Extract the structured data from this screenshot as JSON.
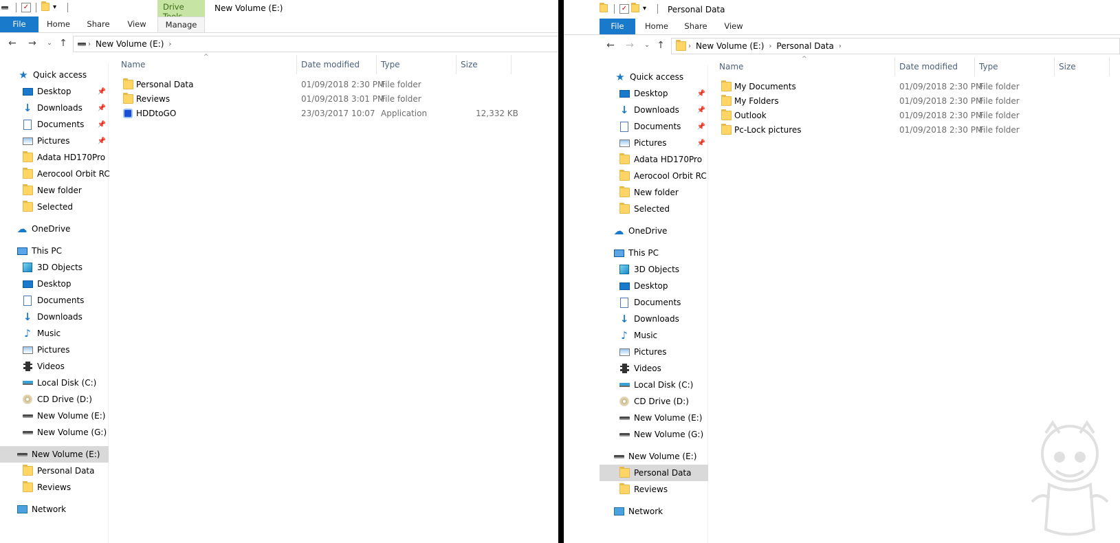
{
  "left": {
    "title": "New Volume (E:)",
    "context_tab_group": "Drive Tools",
    "tabs": {
      "file": "File",
      "home": "Home",
      "share": "Share",
      "view": "View",
      "manage": "Manage"
    },
    "address": {
      "crumb1": "New Volume (E:)"
    },
    "columns": {
      "name": "Name",
      "date": "Date modified",
      "type": "Type",
      "size": "Size"
    },
    "files": [
      {
        "name": "Personal Data",
        "date": "01/09/2018 2:30 PM",
        "type": "File folder",
        "size": ""
      },
      {
        "name": "Reviews",
        "date": "01/09/2018 3:01 PM",
        "type": "File folder",
        "size": ""
      },
      {
        "name": "HDDtoGO",
        "date": "23/03/2017 10:07",
        "type": "Application",
        "size": "12,332 KB"
      }
    ],
    "nav": {
      "quick_access": "Quick access",
      "qa_items": [
        "Desktop",
        "Downloads",
        "Documents",
        "Pictures",
        "Adata HD170Pro",
        "Aerocool Orbit RC",
        "New folder",
        "Selected"
      ],
      "onedrive": "OneDrive",
      "this_pc": "This PC",
      "pc_items": [
        "3D Objects",
        "Desktop",
        "Documents",
        "Downloads",
        "Music",
        "Pictures",
        "Videos",
        "Local Disk (C:)",
        "CD Drive (D:)",
        "New Volume (E:)",
        "New Volume (G:)"
      ],
      "expanded_drive": "New Volume (E:)",
      "drive_items": [
        "Personal Data",
        "Reviews"
      ],
      "network": "Network"
    }
  },
  "right": {
    "title": "Personal Data",
    "tabs": {
      "file": "File",
      "home": "Home",
      "share": "Share",
      "view": "View"
    },
    "address": {
      "crumb1": "New Volume (E:)",
      "crumb2": "Personal Data"
    },
    "columns": {
      "name": "Name",
      "date": "Date modified",
      "type": "Type",
      "size": "Size"
    },
    "files": [
      {
        "name": "My Documents",
        "date": "01/09/2018 2:30 PM",
        "type": "File folder"
      },
      {
        "name": "My Folders",
        "date": "01/09/2018 2:30 PM",
        "type": "File folder"
      },
      {
        "name": "Outlook",
        "date": "01/09/2018 2:30 PM",
        "type": "File folder"
      },
      {
        "name": "Pc-Lock pictures",
        "date": "01/09/2018 2:30 PM",
        "type": "File folder"
      }
    ],
    "nav": {
      "quick_access": "Quick access",
      "qa_items": [
        "Desktop",
        "Downloads",
        "Documents",
        "Pictures",
        "Adata HD170Pro",
        "Aerocool Orbit RC",
        "New folder",
        "Selected"
      ],
      "onedrive": "OneDrive",
      "this_pc": "This PC",
      "pc_items": [
        "3D Objects",
        "Desktop",
        "Documents",
        "Downloads",
        "Music",
        "Pictures",
        "Videos",
        "Local Disk (C:)",
        "CD Drive (D:)",
        "New Volume (E:)",
        "New Volume (G:)"
      ],
      "expanded_drive": "New Volume (E:)",
      "drive_items": [
        "Personal Data",
        "Reviews"
      ],
      "network": "Network"
    }
  },
  "colors": {
    "file_tab": "#1979ca",
    "context_tab": "#c6e5a5",
    "selected": "#d9d9d9",
    "header_text": "#4c607a"
  }
}
